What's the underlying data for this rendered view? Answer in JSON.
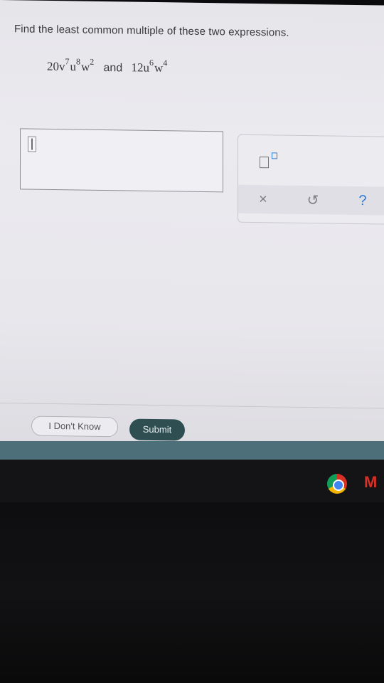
{
  "question": {
    "prompt": "Find the least common multiple of these two expressions.",
    "expr1": {
      "coef": "20",
      "v": "v",
      "v_exp": "7",
      "u": "u",
      "u_exp": "8",
      "w": "w",
      "w_exp": "2"
    },
    "joiner": "and",
    "expr2": {
      "coef": "12",
      "u": "u",
      "u_exp": "6",
      "w": "w",
      "w_exp": "4"
    }
  },
  "answer": {
    "value": ""
  },
  "toolbar": {
    "clear_label": "×",
    "undo_label": "↺",
    "help_label": "?"
  },
  "actions": {
    "dont_know_label": "I Don't Know",
    "submit_label": "Submit"
  },
  "colors": {
    "submit": "#2f4e52",
    "accent": "#2f7bd4",
    "chrome_red": "#d93025"
  },
  "taskbar": {
    "icons": [
      "chrome-icon",
      "gmail-icon"
    ]
  }
}
